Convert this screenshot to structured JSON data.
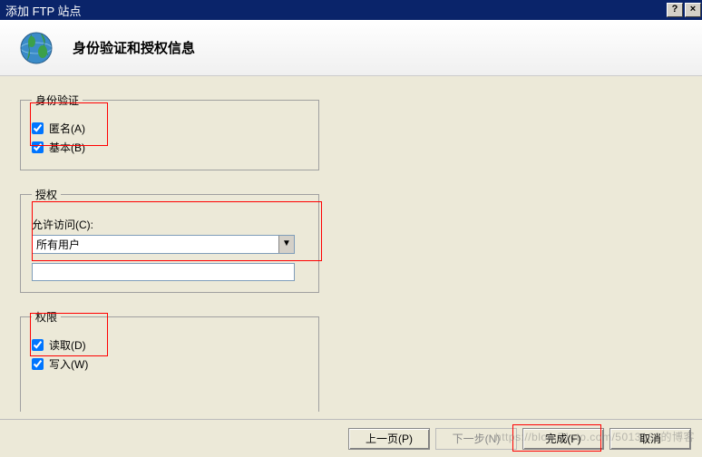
{
  "window": {
    "title": "添加 FTP 站点",
    "help": "?",
    "close": "×"
  },
  "header": {
    "title": "身份验证和授权信息"
  },
  "auth": {
    "legend": "身份验证",
    "anonymous": {
      "label": "匿名(A)",
      "checked": true
    },
    "basic": {
      "label": "基本(B)",
      "checked": true
    }
  },
  "authz": {
    "legend": "授权",
    "access_label": "允许访问(C):",
    "access_value": "所有用户",
    "input_value": ""
  },
  "perm": {
    "legend": "权限",
    "read": {
      "label": "读取(D)",
      "checked": true
    },
    "write": {
      "label": "写入(W)",
      "checked": true
    }
  },
  "footer": {
    "prev": "上一页(P)",
    "next": "下一步(N)",
    "finish": "完成(F)",
    "cancel": "取消"
  },
  "watermark": "https://blog.51cto.com/5013162的博客"
}
